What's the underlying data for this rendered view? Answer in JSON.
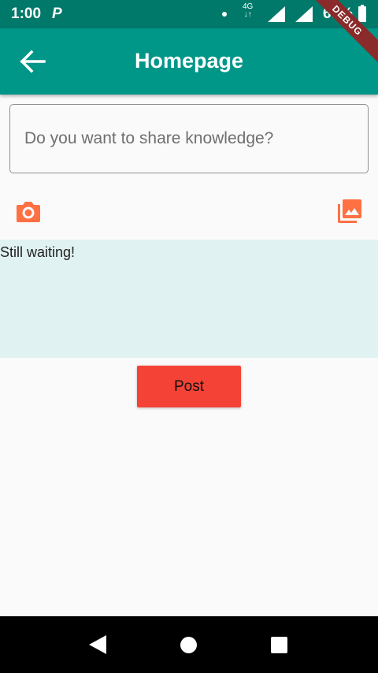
{
  "status_bar": {
    "time": "1:00",
    "notification_letter": "P",
    "network_top": "4G",
    "network_bottom": "↓↑",
    "battery": "69%"
  },
  "app_bar": {
    "title": "Homepage",
    "debug_label": "DEBUG"
  },
  "composer": {
    "placeholder": "Do you want to share knowledge?",
    "value": ""
  },
  "preview": {
    "status_text": "Still waiting!"
  },
  "actions": {
    "post_label": "Post"
  },
  "colors": {
    "status_bar": "#00796b",
    "app_bar": "#009688",
    "icon_accent": "#ff7043",
    "preview_bg": "#e0f2f1",
    "post_button": "#f44336"
  },
  "icons": {
    "back": "arrow-back-icon",
    "camera": "camera-icon",
    "gallery": "photo-library-icon"
  }
}
